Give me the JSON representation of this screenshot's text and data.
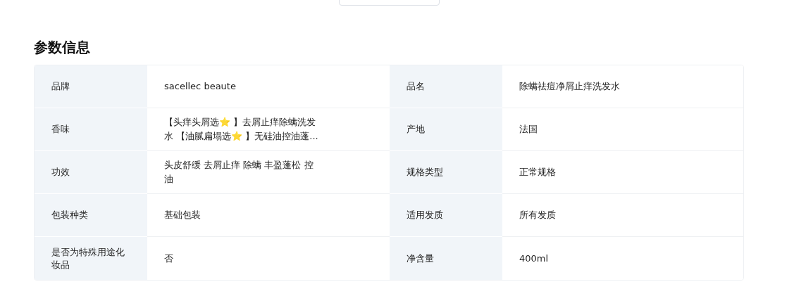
{
  "section_title": "参数信息",
  "params": [
    {
      "label": "品牌",
      "value": "sacellec beaute"
    },
    {
      "label": "品名",
      "value": "除螨祛痘净屑止痒洗发水"
    },
    {
      "label": "香味",
      "value": "【头痒头屑选⭐ 】去屑止痒除螨洗发水 【油腻扁塌选⭐ 】无硅油控油蓬..."
    },
    {
      "label": "产地",
      "value": "法国"
    },
    {
      "label": "功效",
      "value": "头皮舒缓 去屑止痒 除螨 丰盈蓬松 控油"
    },
    {
      "label": "规格类型",
      "value": "正常规格"
    },
    {
      "label": "包装种类",
      "value": "基础包装"
    },
    {
      "label": "适用发质",
      "value": "所有发质"
    },
    {
      "label": "是否为特殊用途化妆品",
      "value": "否"
    },
    {
      "label": "净含量",
      "value": "400ml"
    }
  ]
}
